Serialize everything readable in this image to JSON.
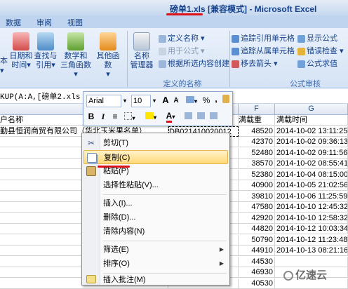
{
  "window": {
    "title": "磅单1.xls  [兼容模式] - Microsoft Excel"
  },
  "ribbon_tabs": [
    "数据",
    "审阅",
    "视图"
  ],
  "ribbon": {
    "btn_date": "日期和\n时间▾",
    "btn_lookup": "查找与\n引用▾",
    "btn_math": "数学和\n三角函数▾",
    "btn_other": "其他函数\n▾",
    "btn_name_mgr": "名称\n管理器",
    "define_name": "定义名称 ▾",
    "use_in_formula": "用于公式 ▾",
    "create_from_sel": "根据所选内容创建",
    "group_defined_names": "定义的名称",
    "trace_precedents": "追踪引用单元格",
    "trace_dependents": "追踪从属单元格",
    "remove_arrows": "移去箭头 ▾",
    "show_formulas": "显示公式",
    "error_checking": "错误检查 ▾",
    "evaluate_formula": "公式求值",
    "group_formula_audit": "公式审核",
    "left_partial_1": "本",
    "left_partial_2": "▾"
  },
  "formula_bar": {
    "text": "KUP(A:A,[磅单2.xls"
  },
  "columns": {
    "colE": "E",
    "colF": "F",
    "colG": "G"
  },
  "headers": {
    "customer": "户名称",
    "weight": "满载重",
    "time": "满载时间"
  },
  "first_row": {
    "customer": "勤县恒润商贸有限公司（华北玉米果名单）",
    "code": "DB021410020012"
  },
  "rows": [
    {
      "w": "48520",
      "t": "2014-10-02 13:11:25"
    },
    {
      "w": "42370",
      "t": "2014-10-02 09:36:13"
    },
    {
      "w": "52480",
      "t": "2014-10-02 09:11:56"
    },
    {
      "w": "38570",
      "t": "2014-10-02 08:55:41"
    },
    {
      "w": "52380",
      "t": "2014-10-04 08:15:00"
    },
    {
      "w": "40900",
      "t": "2014-10-05 21:02:56"
    },
    {
      "w": "39810",
      "t": "2014-10-06 11:25:59"
    },
    {
      "w": "47580",
      "t": "2014-10-10 12:45:32"
    },
    {
      "w": "42920",
      "t": "2014-10-10 12:58:32"
    },
    {
      "w": "44820",
      "t": "2014-10-12 10:03:34"
    },
    {
      "w": "50790",
      "t": "2014-10-12 11:23:48"
    },
    {
      "w": "44910",
      "t": "2014-10-13 08:21:16"
    },
    {
      "w": "44530",
      "t": ""
    },
    {
      "w": "46930",
      "t": ""
    },
    {
      "w": "40530",
      "t": ""
    }
  ],
  "mini_toolbar": {
    "font": "Arial",
    "size": "10",
    "grow": "A",
    "shrink": "A",
    "accounting": "▾",
    "percent": "%",
    "comma": ",",
    "bold": "B",
    "italic": "I",
    "align": "≡",
    "fontcolor": "A"
  },
  "context_menu": [
    {
      "label": "剪切(T)",
      "icon": "scissors-icon"
    },
    {
      "label": "复制(C)",
      "icon": "copy-icon"
    },
    {
      "label": "粘贴(P)",
      "icon": "paste-icon"
    },
    {
      "label": "选择性粘贴(V)...",
      "icon": ""
    },
    {
      "label": "插入(I)...",
      "icon": ""
    },
    {
      "label": "删除(D)...",
      "icon": ""
    },
    {
      "label": "清除内容(N)",
      "icon": ""
    },
    {
      "label": "筛选(E)",
      "icon": ""
    },
    {
      "label": "排序(O)",
      "icon": ""
    },
    {
      "label": "插入批注(M)",
      "icon": "comment-icon"
    }
  ],
  "watermark": "亿速云",
  "colors": {
    "highlight": "#ffd877",
    "redline": "#e0101a"
  }
}
